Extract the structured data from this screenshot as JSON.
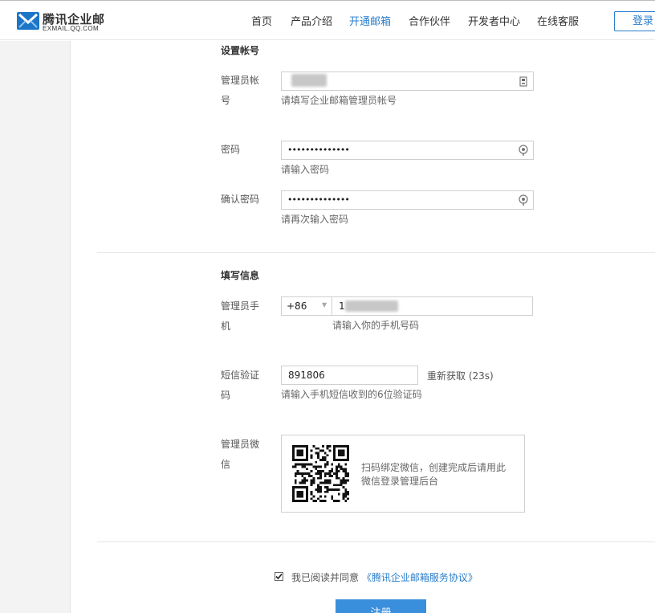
{
  "header": {
    "logo_title": "腾讯企业邮",
    "logo_sub": "EXMAIL.QQ.COM",
    "nav": [
      "首页",
      "产品介绍",
      "开通邮箱",
      "合作伙伴",
      "开发者中心",
      "在线客服"
    ],
    "active_nav": "开通邮箱",
    "login": "登录",
    "accent_color": "#2a7ecb"
  },
  "account_section": {
    "title": "设置帐号",
    "admin_account_label": "管理员帐号",
    "admin_account_hint": "请填写企业邮箱管理员帐号",
    "password_label": "密码",
    "password_value": "••••••••••••••",
    "password_hint": "请输入密码",
    "confirm_label": "确认密码",
    "confirm_value": "••••••••••••••",
    "confirm_hint": "请再次输入密码"
  },
  "info_section": {
    "title": "填写信息",
    "phone_label": "管理员手机",
    "country_code": "+86",
    "phone_prefix": "1",
    "phone_hint": "请输入你的手机号码",
    "sms_label": "短信验证码",
    "sms_value": "891806",
    "sms_hint": "请输入手机短信收到的6位验证码",
    "resend": "重新获取 (23s)",
    "wechat_label": "管理员微信",
    "wechat_text": "扫码绑定微信，创建完成后请用此微信登录管理后台"
  },
  "agreement": {
    "text": "我已阅读并同意",
    "link": "《腾讯企业邮箱服务协议》",
    "checked": true
  },
  "submit": "注册"
}
